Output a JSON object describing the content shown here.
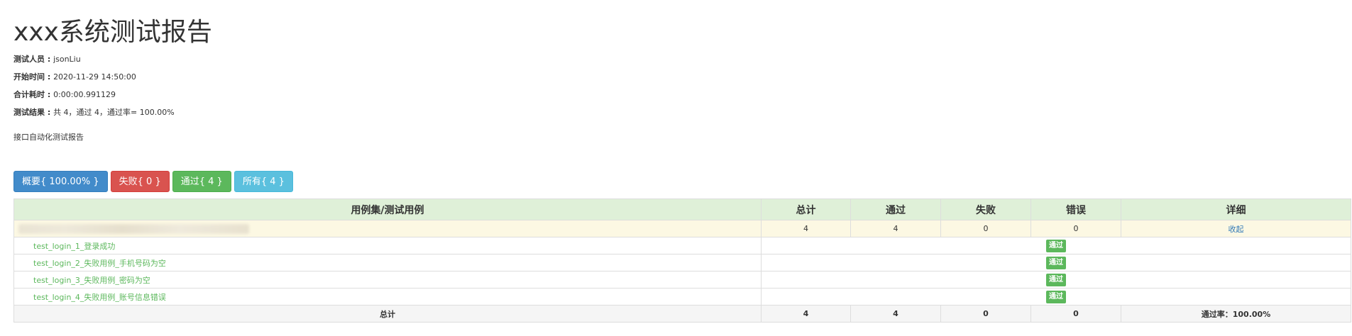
{
  "report": {
    "title": "xxx系统测试报告",
    "meta": [
      {
        "key": "测试人员 : ",
        "value": "jsonLiu"
      },
      {
        "key": "开始时间 : ",
        "value": "2020-11-29 14:50:00"
      },
      {
        "key": "合计耗时 : ",
        "value": "0:00:00.991129"
      },
      {
        "key": "测试结果 : ",
        "value": "共 4，通过 4，通过率= 100.00%"
      }
    ],
    "description": "接口自动化测试报告"
  },
  "filters": {
    "summary": "概要{ 100.00% }",
    "failed": "失败{ 0 }",
    "passed": "通过{ 4 }",
    "all": "所有{ 4 }"
  },
  "table": {
    "headers": [
      "用例集/测试用例",
      "总计",
      "通过",
      "失败",
      "错误",
      "详细"
    ],
    "suite": {
      "total": "4",
      "passed": "4",
      "failed": "0",
      "errors": "0",
      "detail_link": "收起"
    },
    "cases": [
      {
        "name": "test_login_1_登录成功",
        "status": "通过"
      },
      {
        "name": "test_login_2_失败用例_手机号码为空",
        "status": "通过"
      },
      {
        "name": "test_login_3_失败用例_密码为空",
        "status": "通过"
      },
      {
        "name": "test_login_4_失败用例_账号信息错误",
        "status": "通过"
      }
    ],
    "totals": {
      "label": "总计",
      "total": "4",
      "passed": "4",
      "failed": "0",
      "errors": "0",
      "pass_rate": "通过率：100.00%"
    }
  },
  "colors": {
    "primary": "#428bca",
    "danger": "#d9534f",
    "success": "#5cb85c",
    "info": "#5bc0de",
    "header_bg": "#dff0d8",
    "suite_bg": "#fcf8e3"
  }
}
